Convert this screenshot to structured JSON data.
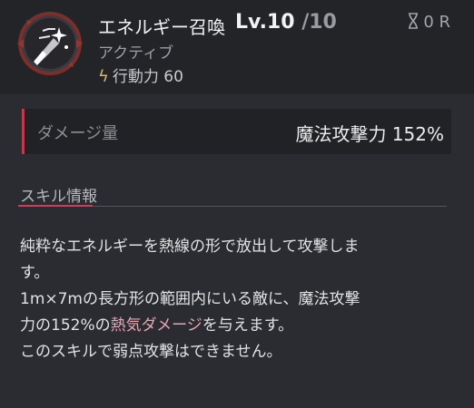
{
  "skill": {
    "name": "エネルギー召喚",
    "level_label": "Lv.10",
    "level_max": "/10",
    "type": "アクティブ",
    "cost_label": "行動力 60",
    "cooldown": "0 R",
    "icon": "energy-summon-icon"
  },
  "damage": {
    "label": "ダメージ量",
    "value": "魔法攻撃力 152%"
  },
  "info": {
    "title": "スキル情報",
    "desc_line1": "純粋なエネルギーを熱線の形で放出して攻撃しま",
    "desc_line2": "す。",
    "desc_line3": "1m×7mの長方形の範囲内にいる敵に、魔法攻撃",
    "desc_line4_pre": "力の152%の",
    "desc_line4_hl": "熱気ダメージ",
    "desc_line4_post": "を与えます。",
    "desc_line5": "このスキルで弱点攻撃はできません。"
  },
  "colors": {
    "accent": "#c0394f",
    "highlight": "#e6a6b2",
    "background": "#2b2c31",
    "header": "#232428"
  }
}
